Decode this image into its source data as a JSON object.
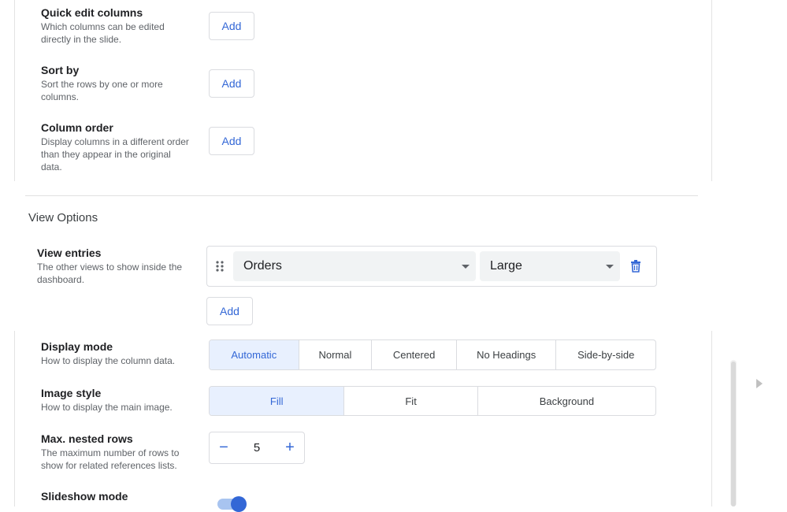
{
  "quick_edit": {
    "title": "Quick edit columns",
    "desc_line1": "Which columns can be edited",
    "desc_line2": "directly in the slide.",
    "add_label": "Add"
  },
  "sort_by": {
    "title": "Sort by",
    "desc_line1": "Sort the rows by one or more",
    "desc_line2": "columns.",
    "add_label": "Add"
  },
  "column_order": {
    "title": "Column order",
    "desc_line1": "Display columns in a different order",
    "desc_line2": "than they appear in the original",
    "desc_line3": "data.",
    "add_label": "Add"
  },
  "view_options": {
    "section_title": "View Options",
    "view_entries": {
      "title": "View entries",
      "desc_line1": "The other views to show inside the",
      "desc_line2": "dashboard.",
      "entry": {
        "view": "Orders",
        "size": "Large"
      },
      "add_label": "Add"
    }
  },
  "display_mode": {
    "title": "Display mode",
    "desc": "How to display the column data.",
    "options": [
      "Automatic",
      "Normal",
      "Centered",
      "No Headings",
      "Side-by-side"
    ],
    "selected": "Automatic"
  },
  "image_style": {
    "title": "Image style",
    "desc": "How to display the main image.",
    "options": [
      "Fill",
      "Fit",
      "Background"
    ],
    "selected": "Fill"
  },
  "max_nested_rows": {
    "title": "Max. nested rows",
    "desc_line1": "The maximum number of rows to",
    "desc_line2": "show for related references lists.",
    "value": "5",
    "minus": "−",
    "plus": "+"
  },
  "slideshow_mode": {
    "title": "Slideshow mode",
    "enabled": true
  },
  "colors": {
    "accent": "#3367d6",
    "active_bg": "#e8f0fe",
    "toggle_thumb": "#3367d6",
    "toggle_track": "#a8c4f0"
  }
}
